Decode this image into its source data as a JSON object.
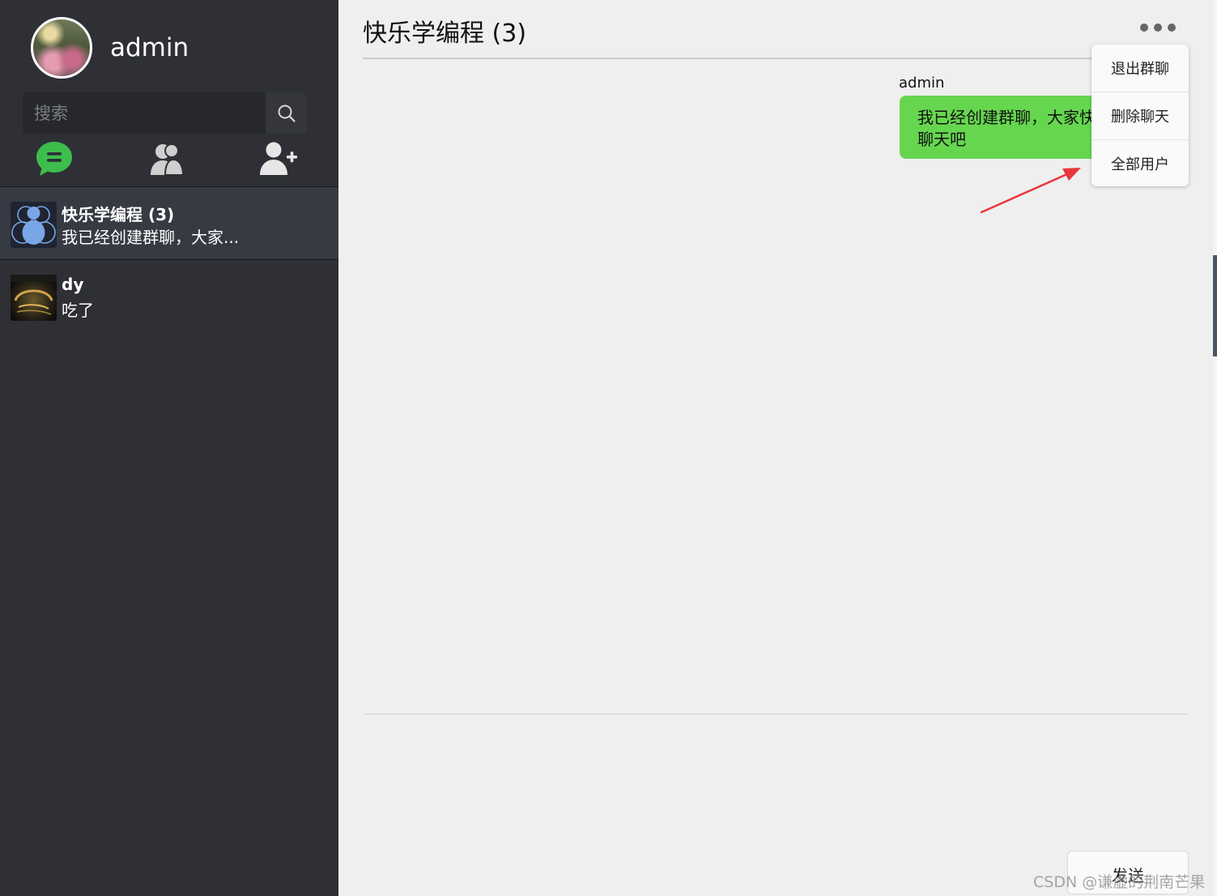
{
  "sidebar": {
    "username": "admin",
    "search": {
      "placeholder": "搜索"
    },
    "nav": [
      "chat-bubble-icon",
      "contacts-icon",
      "add-user-icon"
    ],
    "sessions": [
      {
        "name": "快乐学编程 (3)",
        "last_message": "我已经创建群聊，大家...",
        "active": true
      },
      {
        "name": "dy",
        "last_message": "吃了",
        "active": false
      }
    ]
  },
  "chat": {
    "title": "快乐学编程 (3)",
    "messages": [
      {
        "author": "admin",
        "text": "我已经创建群聊，大家快来聊天吧"
      }
    ],
    "menu": [
      "退出群聊",
      "删除聊天",
      "全部用户"
    ],
    "send_label": "发送"
  },
  "watermark": "CSDN @谦虚的荆南芒果",
  "colors": {
    "sidebar_bg": "#2e3036",
    "active_session_bg": "#363a43",
    "chat_icon_green": "#3dbd4b",
    "bubble_green": "#66d64f",
    "annotation_arrow": "#e8373b"
  }
}
